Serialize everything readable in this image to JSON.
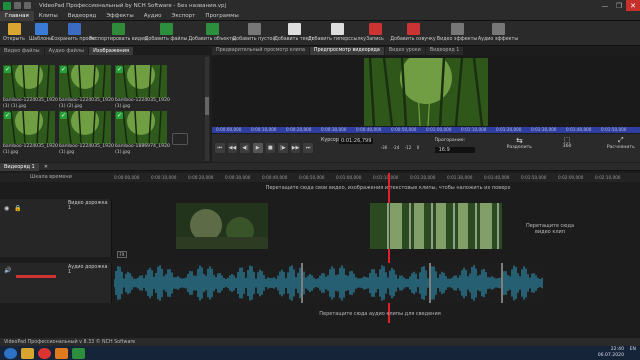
{
  "window": {
    "title": "VideoPad Профессиональный by NCH Software - Без названия.vpj",
    "min": "—",
    "max": "❐",
    "close": "✕"
  },
  "menu": [
    "Главная",
    "Клипы",
    "Видеоряд",
    "Эффекты",
    "Аудио",
    "Экспорт",
    "Программы"
  ],
  "toolbar": [
    {
      "label": "Открыть",
      "icon": "folder-icon",
      "color": "#d9a632"
    },
    {
      "label": "Шаблоны",
      "icon": "templates-icon",
      "color": "#3a7bd5"
    },
    {
      "label": "Сохранить проект",
      "icon": "save-icon",
      "color": "#3b6cc2"
    },
    {
      "label": "Экспортировать видео",
      "icon": "export-icon",
      "color": "#2f8a3a"
    },
    {
      "label": "Добавить файлы",
      "icon": "add-files-icon",
      "color": "#2d8f3d"
    },
    {
      "label": "Добавить объекты",
      "icon": "add-objects-icon",
      "color": "#2d8f3d"
    },
    {
      "label": "Добавить пустой",
      "icon": "add-blank-icon",
      "color": "#777"
    },
    {
      "label": "Добавить текст",
      "icon": "text-icon",
      "color": "#ddd"
    },
    {
      "label": "Добавить гиперссылку",
      "icon": "link-icon",
      "color": "#ddd"
    },
    {
      "label": "Запись",
      "icon": "record-icon",
      "color": "#c33"
    },
    {
      "label": "Добавить озвучку",
      "icon": "narration-icon",
      "color": "#c33"
    },
    {
      "label": "Видео эффекты",
      "icon": "video-effects-icon",
      "color": "#777"
    },
    {
      "label": "Аудио эффекты",
      "icon": "audio-effects-icon",
      "color": "#777"
    }
  ],
  "bin_tabs": [
    "Видео файлы",
    "Аудио файлы",
    "Изображения"
  ],
  "bin_items": [
    {
      "caption": "bamboo-1224035_1920 (1) (1).jpg"
    },
    {
      "caption": "bamboo-1224035_1920 (1) (2).jpg"
    },
    {
      "caption": "bamboo-1224035_1920 (1).jpg"
    },
    {
      "caption": "bamboo-1224035_1920 (1).jpg"
    },
    {
      "caption": "bamboo-1224035_1920 (1).jpg"
    },
    {
      "caption": "bamboo-1886974_1920 (1).jpg"
    }
  ],
  "preview_tabs": [
    "Предварительный просмотр клипа",
    "Предпросмотр видеоряда",
    "Видео уроки",
    "Видеоряд 1"
  ],
  "preview_ruler": [
    "0:00:00,000",
    "0:00:10,000",
    "0:00:20,000",
    "0:00:30,000",
    "0:00:40,000",
    "0:00:50,000",
    "0:01:00,000",
    "0:01:10,000",
    "0:01:20,000",
    "0:01:30,000",
    "0:01:40,000",
    "0:01:50,000"
  ],
  "transport": {
    "cursor_label": "Курсор:",
    "cursor_value": "0:01:26,799",
    "aspect": "16:9",
    "prog_label": "Прогорание:",
    "scale_marks": [
      "-36",
      "-24",
      "-12",
      "0"
    ],
    "split_label": "Разделить",
    "vr_label": "360",
    "unlink_label": "Расчленить"
  },
  "sequence_tab": "Видеоряд 1",
  "timeline_header": [
    "Шкала времени"
  ],
  "timescale_label": "Шкала времени",
  "timescale_ticks": [
    "0:00:00,000",
    "0:00:10,000",
    "0:00:20,000",
    "0:00:30,000",
    "0:00:40,000",
    "0:00:50,000",
    "0:01:00,000",
    "0:01:10,000",
    "0:01:20,000",
    "0:01:30,000",
    "0:01:40,000",
    "0:01:50,000",
    "0:02:00,000",
    "0:02:10,000"
  ],
  "video_hint": "Перетащите сюда свои видео, изображения и текстовые клипы, чтобы наложить их поверх",
  "video_track_name": "Видео дорожка 1",
  "video_drop_hint": "Перетащите сюда видео клип",
  "audio_track_name": "Аудио дорожка 1",
  "audio_hint": "Перетащите сюда аудио клипы для сведения",
  "status": "VideoPad Профессиональный v 8.33 © NCH Software",
  "taskbar": {
    "lang": "EN",
    "time": "22:40",
    "date": "06.07.2020"
  }
}
